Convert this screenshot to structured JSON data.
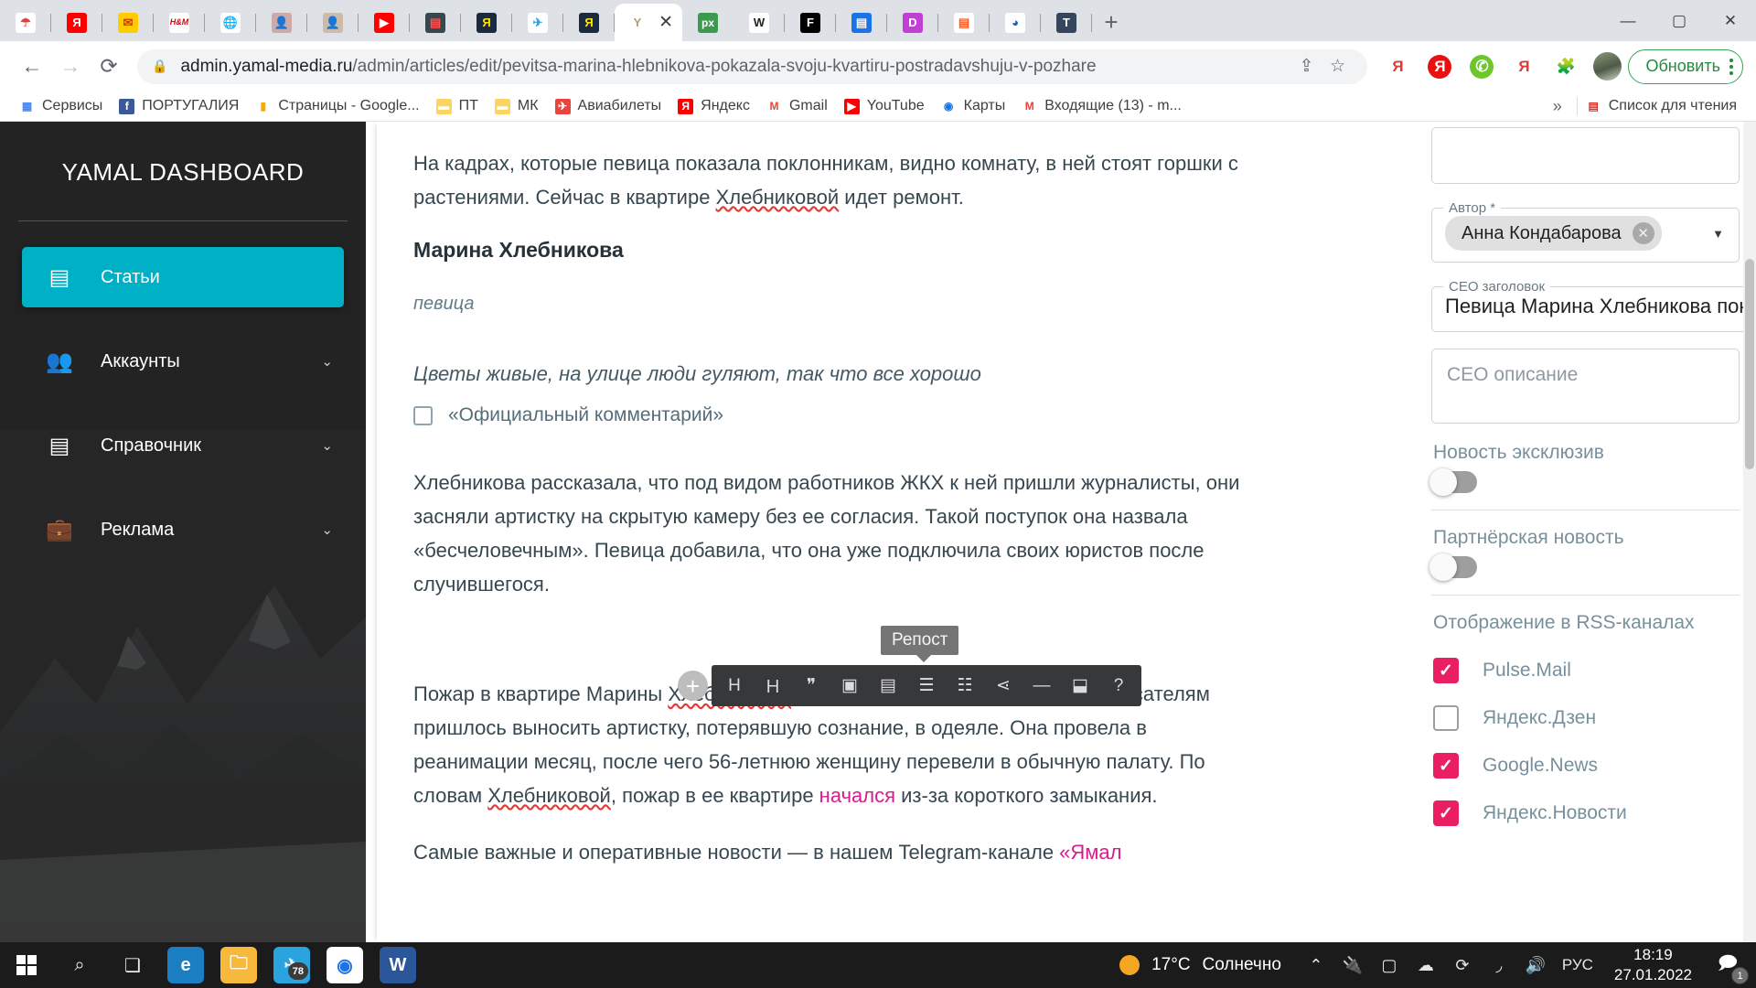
{
  "browser": {
    "tabs": [
      {
        "icon": "umbrella-icon",
        "bg": "#ffffff",
        "glyph": "☂",
        "color": "#e23b3b"
      },
      {
        "icon": "yandex-icon",
        "bg": "#ff0000",
        "glyph": "Я",
        "color": "#ffffff"
      },
      {
        "icon": "yandex-mail-icon",
        "bg": "#ffcc00",
        "glyph": "✉",
        "color": "#d93025"
      },
      {
        "icon": "hm-icon",
        "bg": "#ffffff",
        "glyph": "H&M",
        "color": "#e50010"
      },
      {
        "icon": "globe-icon",
        "bg": "#ffffff",
        "glyph": "🌐",
        "color": "#1a73e8"
      },
      {
        "icon": "avatar-photo-icon",
        "bg": "#caa",
        "glyph": "👤",
        "color": "#5b3a29"
      },
      {
        "icon": "avatar-photo-2-icon",
        "bg": "#cba",
        "glyph": "👤",
        "color": "#5b3a29"
      },
      {
        "icon": "youtube-icon",
        "bg": "#ff0000",
        "glyph": "▶",
        "color": "#ffffff"
      },
      {
        "icon": "news-icon",
        "bg": "#37474f",
        "glyph": "▤",
        "color": "#ff5252"
      },
      {
        "icon": "yandex-dark-icon",
        "bg": "#1b2a41",
        "glyph": "Я",
        "color": "#ffe600"
      },
      {
        "icon": "telegram-icon",
        "bg": "#ffffff",
        "glyph": "✈",
        "color": "#2aa2e0"
      },
      {
        "icon": "yandex-dark-2-icon",
        "bg": "#1b2a41",
        "glyph": "Я",
        "color": "#ffe600"
      },
      {
        "icon": "yamal-icon",
        "bg": "#ffffff",
        "glyph": "Y",
        "color": "#b0a070",
        "active": true,
        "close": "✕"
      },
      {
        "icon": "px-icon",
        "bg": "#3c9a4e",
        "glyph": "px",
        "color": "#ffffff"
      },
      {
        "icon": "wikipedia-icon",
        "bg": "#ffffff",
        "glyph": "W",
        "color": "#202122"
      },
      {
        "icon": "fontawesome-icon",
        "bg": "#000000",
        "glyph": "F",
        "color": "#ffffff"
      },
      {
        "icon": "document-icon",
        "bg": "#1a73e8",
        "glyph": "▤",
        "color": "#ffffff"
      },
      {
        "icon": "dribbble-icon",
        "bg": "#c13fd6",
        "glyph": "D",
        "color": "#ffffff"
      },
      {
        "icon": "rss-reader-icon",
        "bg": "#ffffff",
        "glyph": "▤",
        "color": "#ff5722"
      },
      {
        "icon": "globe-blue-icon",
        "bg": "#ffffff",
        "glyph": "◕",
        "color": "#2a5fb8"
      },
      {
        "icon": "tumblr-icon",
        "bg": "#35465c",
        "glyph": "T",
        "color": "#ffffff"
      }
    ],
    "new_tab_label": "+",
    "window_controls": {
      "minimize": "—",
      "maximize": "▢",
      "close": "✕"
    },
    "nav": {
      "back": "←",
      "forward": "→",
      "reload": "⟳"
    },
    "omnibox": {
      "lock_icon": "lock-icon",
      "url_host": "admin.yamal-media.ru",
      "url_path": "/admin/articles/edit/pevitsa-marina-hlebnikova-pokazala-svoju-kvartiru-postradavshuju-v-pozhare",
      "share_icon": "share-icon",
      "bookmark_icon": "star-icon"
    },
    "extensions": [
      {
        "name": "yandex-red-text-icon",
        "glyph": "Я",
        "color": "#e53935",
        "bg": "transparent"
      },
      {
        "name": "yandex-circle-icon",
        "glyph": "Я",
        "color": "#ffffff",
        "bg": "#e81111"
      },
      {
        "name": "green-swirl-icon",
        "glyph": "✆",
        "color": "#ffffff",
        "bg": "#6dc72b"
      },
      {
        "name": "yandex-red-text-2-icon",
        "glyph": "Я",
        "color": "#e53935",
        "bg": "transparent"
      },
      {
        "name": "puzzle-icon",
        "glyph": "🧩",
        "color": "#5f6368",
        "bg": "transparent"
      }
    ],
    "update_button": "Обновить",
    "bookmarks": [
      {
        "label": "Сервисы",
        "icon": "apps-grid-icon",
        "glyph": "▦",
        "bg": "transparent",
        "color": "#4285f4"
      },
      {
        "label": "ПОРТУГАЛИЯ",
        "icon": "facebook-icon",
        "glyph": "f",
        "bg": "#3b5998",
        "color": "#ffffff"
      },
      {
        "label": "Страницы - Google...",
        "icon": "analytics-icon",
        "glyph": "▮",
        "bg": "transparent",
        "color": "#f9ab00"
      },
      {
        "label": "ПТ",
        "icon": "folder-icon",
        "glyph": "▬",
        "bg": "#fcd462",
        "color": "#fcd462"
      },
      {
        "label": "МК",
        "icon": "folder-icon",
        "glyph": "▬",
        "bg": "#fcd462",
        "color": "#fcd462"
      },
      {
        "label": "Авиабилеты",
        "icon": "aviasales-icon",
        "glyph": "✈",
        "bg": "#e8453c",
        "color": "#ffffff"
      },
      {
        "label": "Яндекс",
        "icon": "yandex-icon",
        "glyph": "Я",
        "bg": "#ff0000",
        "color": "#ffffff"
      },
      {
        "label": "Gmail",
        "icon": "gmail-icon",
        "glyph": "M",
        "bg": "transparent",
        "color": "#ea4335"
      },
      {
        "label": "YouTube",
        "icon": "youtube-icon",
        "glyph": "▶",
        "bg": "#ff0000",
        "color": "#ffffff"
      },
      {
        "label": "Карты",
        "icon": "google-maps-icon",
        "glyph": "◉",
        "bg": "transparent",
        "color": "#1a73e8"
      },
      {
        "label": "Входящие (13) - m...",
        "icon": "gmail-icon",
        "glyph": "M",
        "bg": "transparent",
        "color": "#ea4335"
      }
    ],
    "bookmarks_overflow": "»",
    "reading_list": "Список для чтения"
  },
  "sidebar": {
    "brand": "YAMAL DASHBOARD",
    "items": [
      {
        "label": "Статьи",
        "icon": "article-icon",
        "glyph": "▤",
        "active": true,
        "chevron": ""
      },
      {
        "label": "Аккаунты",
        "icon": "people-icon",
        "glyph": "👥",
        "active": false,
        "chevron": "⌄"
      },
      {
        "label": "Справочник",
        "icon": "library-icon",
        "glyph": "▤",
        "active": false,
        "chevron": "⌄"
      },
      {
        "label": "Реклама",
        "icon": "briefcase-icon",
        "glyph": "💼",
        "active": false,
        "chevron": "⌄"
      }
    ]
  },
  "article": {
    "paragraph_1_a": "На кадрах, которые певица показала поклонникам, видно комнату, в ней стоят горшки с растениями. Сейчас в квартире ",
    "paragraph_1_sp": "Хлебниковой",
    "paragraph_1_b": " идет ремонт.",
    "quote": {
      "author_name": "Марина Хлебникова",
      "author_role": "певица",
      "text": "Цветы живые, на улице люди гуляют, так что все хорошо",
      "official_label": "«Официальный комментарий»",
      "controls": {
        "select_checkbox": "quote-select-checkbox",
        "move_down": "⌄",
        "move_up": "⌃",
        "remove": "✕"
      }
    },
    "paragraph_2": "Хлебникова рассказала, что под видом работников ЖКХ к ней пришли журналисты, они засняли артистку на скрытую камеру без ее согласия. Такой поступок она назвала «бесчеловечным». Певица добавила, что она уже подключила своих юристов после случившегося.",
    "paragraph_3_a": "Пожар в квартире Марины ",
    "paragraph_3_sp1": "Хлебниковой",
    "paragraph_3_b": " произошел в ноябре 2021 года. Спасателям пришлось выносить артистку, потерявшую сознание, в одеяле. Она провела в реанимации месяц, после чего 56-летнюю женщину перевели в обычную палату. По словам ",
    "paragraph_3_sp2": "Хлебниковой",
    "paragraph_3_c": ", пожар в ее квартире ",
    "paragraph_3_link": "начался",
    "paragraph_3_d": " из-за короткого замыкания.",
    "paragraph_4_a": "Самые важные и оперативные новости — в нашем Telegram-канале ",
    "paragraph_4_link": "«Ямал"
  },
  "editor_toolbar": {
    "add_button": "+",
    "tooltip": "Репост",
    "tools": [
      {
        "name": "heading-h1-icon",
        "glyph": "H"
      },
      {
        "name": "heading-boxed-icon",
        "glyph": "Ｈ"
      },
      {
        "name": "quote-icon",
        "glyph": "❞"
      },
      {
        "name": "image-icon",
        "glyph": "▣"
      },
      {
        "name": "gallery-icon",
        "glyph": "▤"
      },
      {
        "name": "bullet-list-icon",
        "glyph": "☰"
      },
      {
        "name": "numbered-list-icon",
        "glyph": "☷"
      },
      {
        "name": "share-repost-icon",
        "glyph": "⋖"
      },
      {
        "name": "divider-icon",
        "glyph": "—"
      },
      {
        "name": "html-embed-icon",
        "glyph": "⬓"
      },
      {
        "name": "help-icon",
        "glyph": "?"
      }
    ]
  },
  "right_panel": {
    "top_field_value": "",
    "author": {
      "legend": "Автор *",
      "chip": "Анна Кондабарова",
      "remove": "✕",
      "caret": "▼"
    },
    "seo_title": {
      "legend": "СЕО заголовок",
      "value": "Певица Марина Хлебникова показал"
    },
    "seo_description": {
      "placeholder": "СЕО описание"
    },
    "exclusive": {
      "label": "Новость эксклюзив",
      "on": false
    },
    "partner": {
      "label": "Партнёрская новость",
      "on": false
    },
    "rss": {
      "label": "Отображение в RSS-каналах",
      "items": [
        {
          "label": "Pulse.Mail",
          "checked": true
        },
        {
          "label": "Яндекс.Дзен",
          "checked": false
        },
        {
          "label": "Google.News",
          "checked": true
        },
        {
          "label": "Яндекс.Новости",
          "checked": true
        }
      ]
    }
  },
  "taskbar": {
    "start_icon": "windows-start-icon",
    "search_icon": "search-icon",
    "taskview_icon": "task-view-icon",
    "apps": [
      {
        "name": "microsoft-edge-icon",
        "glyph": "e",
        "bg": "#1b7ec2",
        "color": "#ffffff",
        "badge": ""
      },
      {
        "name": "file-explorer-icon",
        "glyph": "🗀",
        "bg": "#f6b93b",
        "color": "#ffffff",
        "badge": ""
      },
      {
        "name": "telegram-icon",
        "glyph": "✈",
        "bg": "#29a4de",
        "color": "#ffffff",
        "badge": "78"
      },
      {
        "name": "google-chrome-icon",
        "glyph": "◉",
        "bg": "#ffffff",
        "color": "#1a73e8",
        "badge": ""
      },
      {
        "name": "microsoft-word-icon",
        "glyph": "W",
        "bg": "#2b579a",
        "color": "#ffffff",
        "badge": ""
      }
    ],
    "weather": {
      "temp": "17°C",
      "desc": "Солнечно",
      "icon": "sun-icon"
    },
    "tray": [
      {
        "name": "show-hidden-icons-icon",
        "glyph": "⌃"
      },
      {
        "name": "battery-charging-icon",
        "glyph": "🔌"
      },
      {
        "name": "webcam-icon",
        "glyph": "▢"
      },
      {
        "name": "onedrive-icon",
        "glyph": "☁"
      },
      {
        "name": "sync-icon",
        "glyph": "⟳"
      },
      {
        "name": "wifi-icon",
        "glyph": "◞"
      },
      {
        "name": "volume-icon",
        "glyph": "🔊"
      }
    ],
    "language": "РУС",
    "time": "18:19",
    "date": "27.01.2022",
    "notifications": {
      "icon": "notification-icon",
      "count": "1"
    }
  },
  "colors": {
    "accent": "#00b0c7",
    "checkbox_on": "#e91e63",
    "link": "#d81b8c",
    "update_green": "#1e8e3e",
    "sidebar_bg": "#2b2b2b"
  }
}
